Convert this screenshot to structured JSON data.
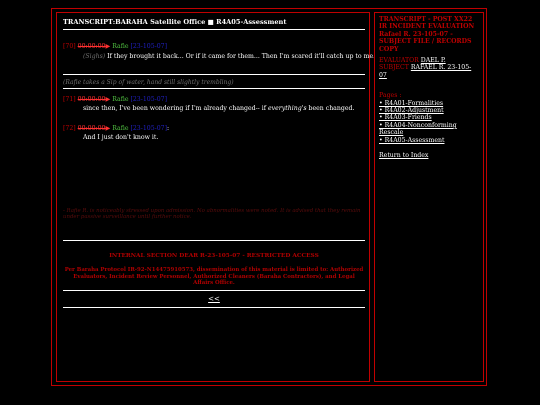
{
  "main": {
    "title": "TRANSCRIPT:BARAHA Satellite Office ■ R4A05-Assessment",
    "entries": [
      {
        "num": "[70]",
        "strike": "00:00:00",
        "arrow": "▶",
        "speaker": "Rafie",
        "ts": "[23-105-07]",
        "body_prefix": "(Sighs)",
        "body": " If they brought it back... Or if it came for them... Then I'm scared it'll catch up to me."
      },
      {
        "num": "[71]",
        "strike": "00:00:00",
        "arrow": "▶",
        "speaker": "Rafie",
        "ts": "[23-105-07]",
        "body": "since then, I've been wondering if I'm already changed-- if ",
        "body_em": "everything's",
        "body_tail": " been changed."
      },
      {
        "num": "[72]",
        "strike": "00:00:00",
        "arrow": "▶",
        "speaker": "Rafie",
        "ts": "[23-105-07]",
        "colon": ":",
        "body": "And I just don't know it."
      }
    ],
    "note": "(Rafie takes a Sip of water, hand still slightly trembling)",
    "faded_note": "- Rafie R. is noticeably stressed upon admission. No abnormalities were noted. It is advised that they remain under passive surveillance until further notice.",
    "internal": "INTERNAL SECTION DEAR R-23-105-07 - RESTRICTED ACCESS",
    "notice": "Per Baraha Protocol IR-92-N14475910573, dissemination of this material is limited to: Authorized Evaluators, Incident Review Personnel, Authorized Cleaners (Baraha Contractors), and Legal Affairs Office.",
    "back": "<<"
  },
  "side": {
    "header": "TRANSCRIPT - POST XX22 IR INCIDENT EVALUATION Rafael R. 23-105-07 - SUBJECT FILE / RECORDS COPY",
    "evaluator_label": "EVALUATOR",
    "evaluator": "DAEL P.",
    "subject_label": "SUBJECT",
    "subject": "RAFAEL R. 23-105-07",
    "pages_label": "Pages :",
    "pages": [
      "• R4A01-Formalities",
      "• R4A02-Adjustment",
      "• R4A03-Friends",
      "• R4A04-Nonconforming Rescale",
      "• R4A05-Assessment"
    ],
    "return": "Return to Index"
  }
}
